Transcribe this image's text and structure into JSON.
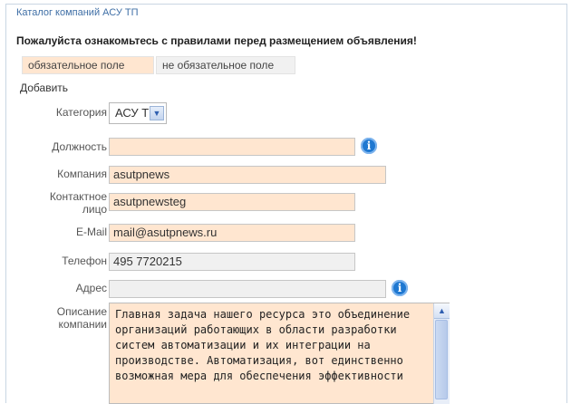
{
  "header": {
    "title": "Каталог компаний АСУ ТП"
  },
  "headline": "Пожалуйста ознакомьтесь с правилами перед размещением объявления!",
  "legend": {
    "required": "обязательное поле",
    "optional": "не обязательное поле"
  },
  "section": {
    "add_label": "Добавить"
  },
  "form": {
    "category": {
      "label": "Категория",
      "value": "АСУ ТП"
    },
    "position": {
      "label": "Должность",
      "value": ""
    },
    "company": {
      "label": "Компания",
      "value": "asutpnews"
    },
    "contact": {
      "label_line1": "Контактное",
      "label_line2": "лицо",
      "value": "asutpnewsteg"
    },
    "email": {
      "label": "E-Mail",
      "value": "mail@asutpnews.ru"
    },
    "phone": {
      "label": "Телефон",
      "value": "495 7720215"
    },
    "address": {
      "label": "Адрес",
      "value": ""
    },
    "description": {
      "label_line1": "Описание",
      "label_line2": "компании",
      "value": "Главная задача нашего ресурса это объединение организаций работающих в области разработки систем автоматизации и их интеграции на производстве. Автоматизация, вот единственно возможная мера для обеспечения эффективности"
    }
  },
  "icons": {
    "info": "info-icon",
    "dropdown": "chevron-down-icon",
    "scroll_up": "arrow-up-icon"
  }
}
